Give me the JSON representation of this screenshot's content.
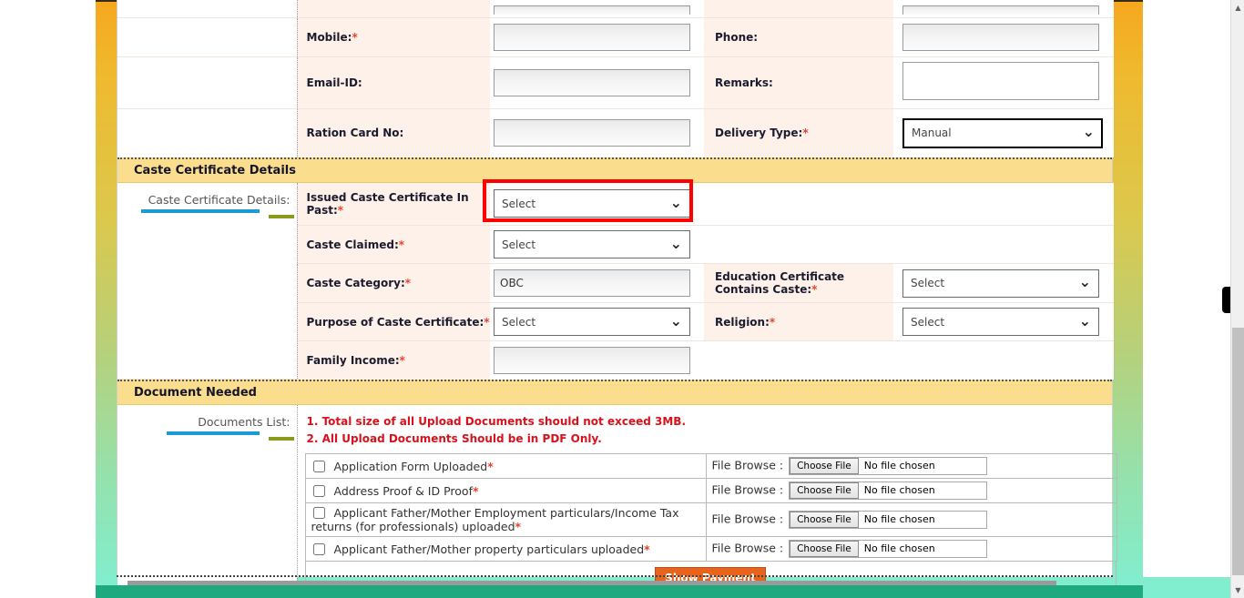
{
  "background": {
    "top_color": "#F5A623",
    "bottom_color": "#7FEFD0"
  },
  "personal_section": {
    "rows": [
      {
        "label": "Mobile:",
        "required": true,
        "field": "input",
        "value": "",
        "right_label": "Phone:",
        "right_required": false,
        "right_field": "input",
        "right_value": ""
      },
      {
        "label": "Email-ID:",
        "required": false,
        "field": "input",
        "value": "",
        "right_label": "Remarks:",
        "right_required": false,
        "right_field": "textarea",
        "right_value": ""
      },
      {
        "label": "Ration Card No:",
        "required": false,
        "field": "input",
        "value": "",
        "right_label": "Delivery Type:",
        "right_required": true,
        "right_field": "select",
        "right_value": "Manual"
      }
    ]
  },
  "caste_section": {
    "header": "Caste Certificate Details",
    "side_label": "Caste Certificate Details:",
    "rows": [
      {
        "label": "Issued Caste Certificate In Past:",
        "required": true,
        "field": "select",
        "value": "Select",
        "highlighted": true,
        "right_label": "",
        "right_field": "none",
        "right_value": ""
      },
      {
        "label": "Caste Claimed:",
        "required": true,
        "field": "select",
        "value": "Select",
        "right_label": "",
        "right_field": "none",
        "right_value": ""
      },
      {
        "label": "Caste Category:",
        "required": true,
        "field": "readonly",
        "value": "OBC",
        "right_label": "Education Certificate Contains Caste:",
        "right_required": true,
        "right_field": "select",
        "right_value": "Select"
      },
      {
        "label": "Purpose of Caste Certificate:",
        "required": true,
        "field": "select",
        "value": "Select",
        "right_label": "Religion:",
        "right_required": true,
        "right_field": "select",
        "right_value": "Select"
      },
      {
        "label": "Family Income:",
        "required": true,
        "field": "input",
        "value": "",
        "right_label": "",
        "right_field": "none",
        "right_value": ""
      }
    ]
  },
  "documents_section": {
    "header": "Document Needed",
    "side_label": "Documents List:",
    "notes": [
      "1. Total size of all Upload Documents should not exceed 3MB.",
      "2. All Upload Documents Should be in PDF Only."
    ],
    "notes_color": "#D8111C",
    "file_browse_label": "File Browse :",
    "choose_file_button": "Choose File",
    "no_file_text": "No file chosen",
    "items": [
      {
        "label": "Application Form Uploaded",
        "required": true,
        "checked": false
      },
      {
        "label": "Address Proof & ID Proof",
        "required": true,
        "checked": false
      },
      {
        "label": "Applicant Father/Mother Employment particulars/Income Tax returns (for professionals) uploaded",
        "required": true,
        "checked": false
      },
      {
        "label": "Applicant Father/Mother property particulars uploaded",
        "required": true,
        "checked": false
      }
    ],
    "submit_button": "Show Payment",
    "submit_button_color": "#E8641C"
  },
  "footer": {
    "text": ""
  },
  "scrollbar": {
    "up_arrow": "▲",
    "down_arrow": "▼"
  }
}
